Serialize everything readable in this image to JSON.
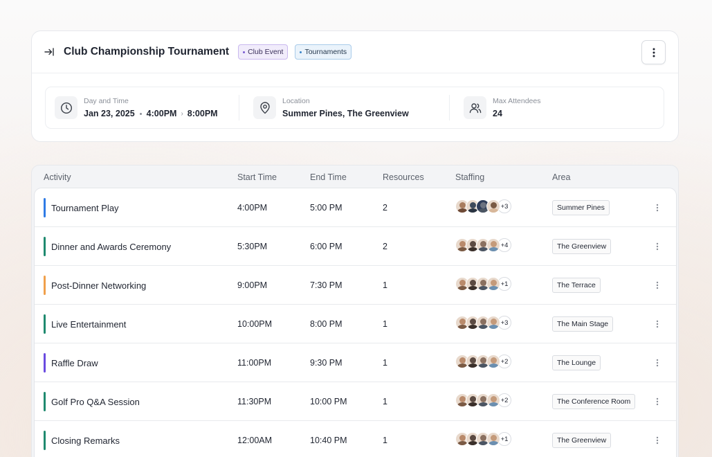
{
  "event": {
    "title": "Club Championship Tournament",
    "tags": [
      {
        "label": "Club Event",
        "color": "#7a5bd0"
      },
      {
        "label": "Tournaments",
        "color": "#3a86c8"
      }
    ],
    "day_time": {
      "label": "Day and Time",
      "date": "Jan 23, 2025",
      "start": "4:00PM",
      "end": "8:00PM"
    },
    "location": {
      "label": "Location",
      "value": "Summer Pines, The Greenview"
    },
    "attendees": {
      "label": "Max Attendees",
      "value": "24"
    }
  },
  "table": {
    "headers": {
      "activity": "Activity",
      "start": "Start Time",
      "end": "End Time",
      "resources": "Resources",
      "staffing": "Staffing",
      "area": "Area"
    },
    "rows": [
      {
        "activity": "Tournament Play",
        "start": "4:00PM",
        "end": "5:00 PM",
        "resources": "2",
        "extra": "+3",
        "area": "Summer Pines",
        "color": "#2f7be5"
      },
      {
        "activity": "Dinner and Awards Ceremony",
        "start": "5:30PM",
        "end": "6:00 PM",
        "resources": "2",
        "extra": "+4",
        "area": "The Greenview",
        "color": "#1f8a6f"
      },
      {
        "activity": "Post-Dinner Networking",
        "start": "9:00PM",
        "end": "7:30 PM",
        "resources": "1",
        "extra": "+1",
        "area": "The Terrace",
        "color": "#f0a04b"
      },
      {
        "activity": "Live Entertainment",
        "start": "10:00PM",
        "end": "8:00 PM",
        "resources": "1",
        "extra": "+3",
        "area": "The Main Stage",
        "color": "#1f8a6f"
      },
      {
        "activity": "Raffle Draw",
        "start": "11:00PM",
        "end": "9:30 PM",
        "resources": "1",
        "extra": "+2",
        "area": "The Lounge",
        "color": "#6a4be0"
      },
      {
        "activity": "Golf Pro Q&A Session",
        "start": "11:30PM",
        "end": "10:00 PM",
        "resources": "1",
        "extra": "+2",
        "area": "The Conference Room",
        "color": "#1f8a6f"
      },
      {
        "activity": "Closing Remarks",
        "start": "12:00AM",
        "end": "10:40 PM",
        "resources": "1",
        "extra": "+1",
        "area": "The Greenview",
        "color": "#1f8a6f"
      }
    ]
  }
}
